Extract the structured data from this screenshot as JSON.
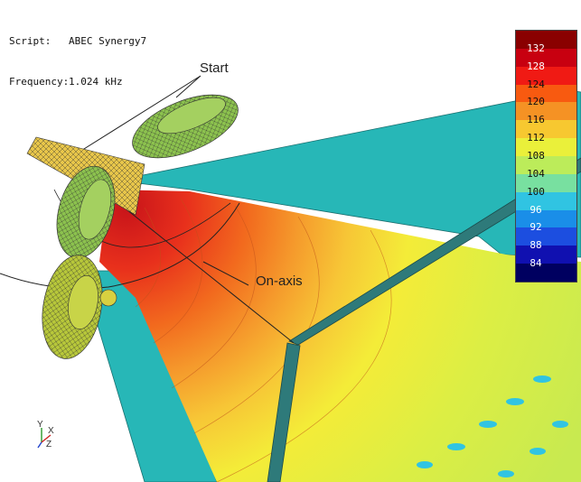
{
  "info": {
    "script_label": "Script:",
    "script_value": "ABEC Synergy7",
    "frequency_label": "Frequency:",
    "frequency_value": "1.024 kHz"
  },
  "callouts": {
    "start": "Start",
    "on_axis": "On-axis"
  },
  "legend": {
    "ticks": [
      "132",
      "128",
      "124",
      "120",
      "116",
      "112",
      "108",
      "104",
      "100",
      "96",
      "92",
      "88",
      "84"
    ],
    "colors": [
      "#8a0000",
      "#c80010",
      "#f01a14",
      "#f85a10",
      "#f59224",
      "#f7c830",
      "#eaf03a",
      "#bcec5a",
      "#78e0a0",
      "#30c4e2",
      "#1a8ee8",
      "#1c4ee0",
      "#1010b0",
      "#000060"
    ]
  },
  "axis_triad": {
    "y_label": "Y",
    "x_label": "X",
    "z_label": "Z"
  }
}
